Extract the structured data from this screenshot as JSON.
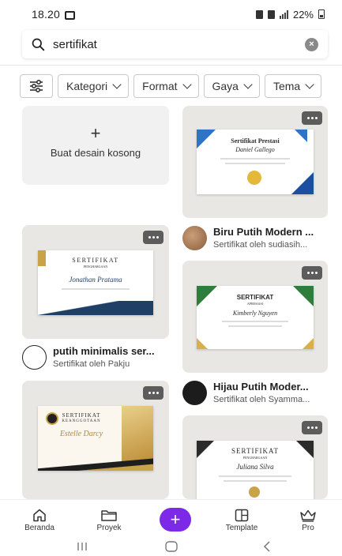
{
  "status_bar": {
    "time": "18.20",
    "battery": "22%"
  },
  "search": {
    "value": "sertifikat",
    "placeholder": ""
  },
  "filters": [
    "Kategori",
    "Format",
    "Gaya",
    "Tema"
  ],
  "blank_card": {
    "plus": "+",
    "label": "Buat desain kosong"
  },
  "templates": [
    {
      "title": "Biru Putih Modern ...",
      "subtitle": "Sertifikat oleh sudiasih...",
      "cert_title": "Sertifikat Prestasi",
      "cert_name": "Daniel Gallego",
      "accent": "#1c4fa0"
    },
    {
      "title": "putih minimalis ser...",
      "subtitle": "Sertifikat oleh Pakju",
      "cert_title": "SERTIFIKAT",
      "cert_sub": "PENGHARGAAN",
      "cert_name": "Jonathan Pratama",
      "accent": "#1f3f67"
    },
    {
      "title": "Hijau Putih Moder...",
      "subtitle": "Sertifikat oleh Syamma...",
      "cert_title": "SERTIFIKAT",
      "cert_sub": "APRESIASI",
      "cert_name": "Kimberly Nguyen",
      "accent": "#2e7d3a"
    },
    {
      "cert_title": "SERTIFIKAT",
      "cert_sub": "KEANGGOTAAN",
      "cert_name": "Estelle Darcy",
      "accent": "#c9a24a"
    },
    {
      "cert_title": "SERTIFIKAT",
      "cert_sub": "PENGHARGAAN",
      "cert_name": "Juliana Silva",
      "accent": "#2b2b2b"
    }
  ],
  "bottom_nav": [
    "Beranda",
    "Proyek",
    "Template",
    "Pro"
  ],
  "fab_label": "+"
}
